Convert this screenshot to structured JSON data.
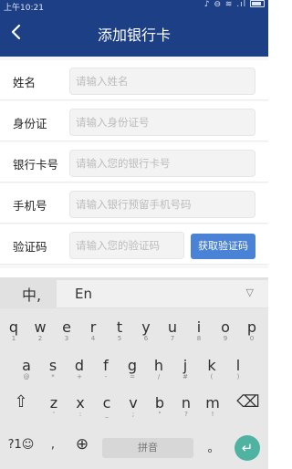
{
  "status": {
    "time": "上午10:21",
    "icons": "♪ ⊖ ≋ .ıl"
  },
  "header": {
    "title": "添加银行卡"
  },
  "form": {
    "rows": [
      {
        "label": "姓名",
        "placeholder": "请输入姓名"
      },
      {
        "label": "身份证",
        "placeholder": "请输入身份证号"
      },
      {
        "label": "银行卡号",
        "placeholder": "请输入您的银行卡号"
      },
      {
        "label": "手机号",
        "placeholder": "请输入银行预留手机号码"
      },
      {
        "label": "验证码",
        "placeholder": "请输入您的验证码"
      }
    ],
    "get_code": "获取验证码"
  },
  "keyboard": {
    "zh": "中,",
    "lang": "En",
    "tri": "▽",
    "row1": [
      {
        "k": "q",
        "s": "1"
      },
      {
        "k": "w",
        "s": "2"
      },
      {
        "k": "e",
        "s": "3"
      },
      {
        "k": "r",
        "s": "4"
      },
      {
        "k": "t",
        "s": "5"
      },
      {
        "k": "y",
        "s": "6"
      },
      {
        "k": "u",
        "s": "7"
      },
      {
        "k": "i",
        "s": "8"
      },
      {
        "k": "o",
        "s": "9"
      },
      {
        "k": "p",
        "s": "0"
      }
    ],
    "row2": [
      {
        "k": "a",
        "s": "@"
      },
      {
        "k": "s",
        "s": "*"
      },
      {
        "k": "d",
        "s": "+"
      },
      {
        "k": "f",
        "s": "-"
      },
      {
        "k": "g",
        "s": "="
      },
      {
        "k": "h",
        "s": "/"
      },
      {
        "k": "j",
        "s": "#"
      },
      {
        "k": "k",
        "s": "("
      },
      {
        "k": "l",
        "s": ")"
      }
    ],
    "row3": [
      {
        "k": "z",
        "s": "'"
      },
      {
        "k": "x",
        "s": ":"
      },
      {
        "k": "c",
        "s": "_"
      },
      {
        "k": "v",
        "s": ";"
      },
      {
        "k": "b",
        "s": "\""
      },
      {
        "k": "n",
        "s": "?"
      },
      {
        "k": "m",
        "s": "!"
      }
    ],
    "shift": "⇧",
    "backspace": "⌫",
    "symbols": "?1☺",
    "comma": ",",
    "globe": "⊕",
    "space": "拼音",
    "period": "。",
    "enter": "↵"
  }
}
